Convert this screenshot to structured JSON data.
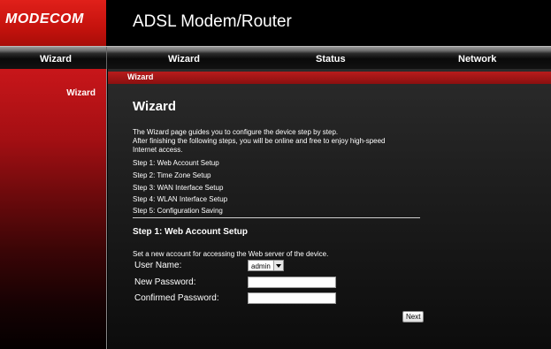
{
  "header": {
    "logo_text": "MODECOM",
    "app_title": "ADSL Modem/Router"
  },
  "nav": {
    "left_label": "Wizard",
    "items": [
      {
        "label": "Wizard"
      },
      {
        "label": "Status"
      },
      {
        "label": "Network"
      }
    ]
  },
  "sidebar": {
    "items": [
      {
        "label": "Wizard"
      }
    ]
  },
  "main": {
    "breadcrumb": "Wizard",
    "title": "Wizard",
    "description_lines": [
      "The Wizard page guides you to configure the device step by step.",
      "After finishing the following steps, you will be online and free to enjoy high-speed",
      "Internet access."
    ],
    "steps": [
      "Step 1: Web Account Setup",
      "Step 2: Time Zone Setup",
      "Step 3: WAN Interface Setup",
      "Step 4: WLAN Interface Setup",
      "Step 5: Configuration Saving"
    ],
    "section_title": "Step 1: Web Account Setup",
    "section_desc": "Set a new account for accessing the Web server of the device.",
    "form": {
      "user_name_label": "User Name:",
      "user_name_value": "admin",
      "new_password_label": "New Password:",
      "new_password_value": "",
      "confirmed_password_label": "Confirmed Password:",
      "confirmed_password_value": ""
    },
    "next_label": "Next"
  },
  "colors": {
    "brand_red": "#c5120d",
    "crumb_red": "#a01515",
    "background": "#000000"
  }
}
